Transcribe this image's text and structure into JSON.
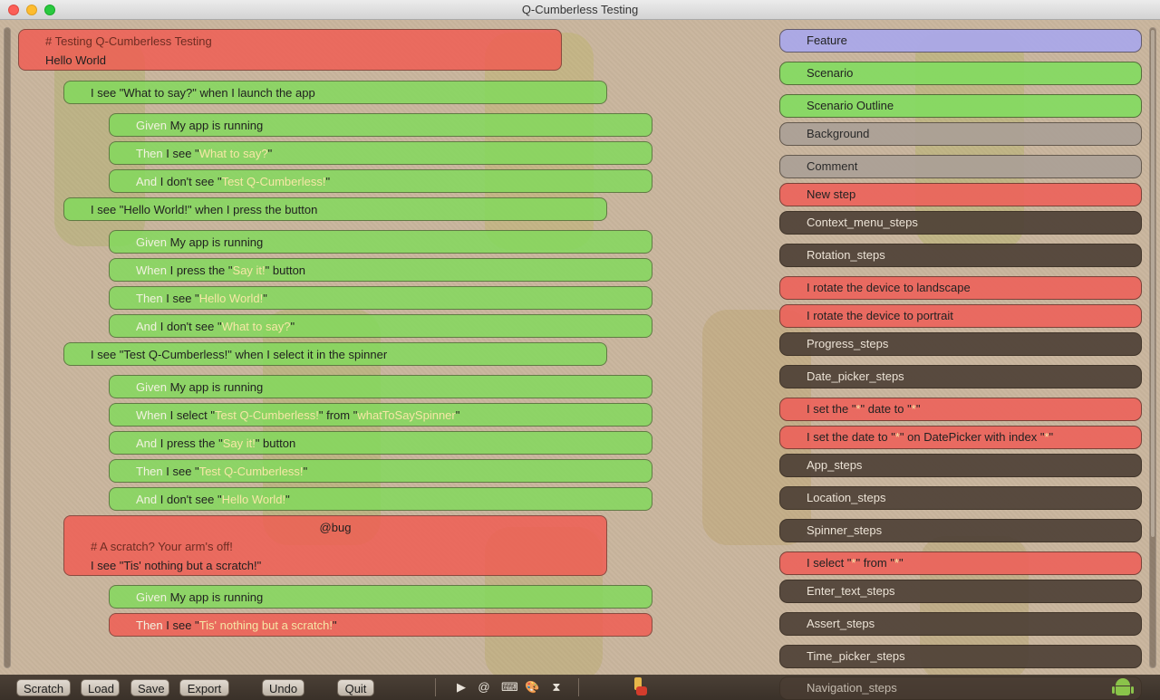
{
  "window": {
    "title": "Q-Cumberless Testing"
  },
  "editor": {
    "feature": {
      "comment": "# Testing Q-Cumberless Testing",
      "name": "Hello World"
    },
    "scenarios": [
      {
        "title": "I see \"What to say?\" when I launch the app",
        "steps": [
          {
            "keyword": "Given",
            "pre": "My app is running",
            "q1": "",
            "mid": "",
            "q2": "",
            "post": "",
            "result": "pass"
          },
          {
            "keyword": "Then",
            "pre": "I see \"",
            "q1": "What to say?",
            "mid": "\"",
            "q2": "",
            "post": "",
            "result": "pass"
          },
          {
            "keyword": "And",
            "pre": "I don't see \"",
            "q1": "Test Q-Cumberless!",
            "mid": "\"",
            "q2": "",
            "post": "",
            "result": "pass"
          }
        ]
      },
      {
        "title": "I see \"Hello World!\" when I press the button",
        "steps": [
          {
            "keyword": "Given",
            "pre": "My app is running",
            "q1": "",
            "mid": "",
            "q2": "",
            "post": "",
            "result": "pass"
          },
          {
            "keyword": "When",
            "pre": "I press the \"",
            "q1": "Say it!",
            "mid": "\" button",
            "q2": "",
            "post": "",
            "result": "pass"
          },
          {
            "keyword": "Then",
            "pre": "I see \"",
            "q1": "Hello World!",
            "mid": "\"",
            "q2": "",
            "post": "",
            "result": "pass"
          },
          {
            "keyword": "And",
            "pre": "I don't see \"",
            "q1": "What to say?",
            "mid": "\"",
            "q2": "",
            "post": "",
            "result": "pass"
          }
        ]
      },
      {
        "title": "I see \"Test Q-Cumberless!\" when I select it in the spinner",
        "steps": [
          {
            "keyword": "Given",
            "pre": "My app is running",
            "q1": "",
            "mid": "",
            "q2": "",
            "post": "",
            "result": "pass"
          },
          {
            "keyword": "When",
            "pre": "I select \"",
            "q1": "Test Q-Cumberless!",
            "mid": "\" from \"",
            "q2": "whatToSaySpinner",
            "post": "\"",
            "result": "pass"
          },
          {
            "keyword": "And",
            "pre": "I press the \"",
            "q1": "Say it!",
            "mid": "\" button",
            "q2": "",
            "post": "",
            "result": "pass"
          },
          {
            "keyword": "Then",
            "pre": "I see \"",
            "q1": "Test Q-Cumberless!",
            "mid": "\"",
            "q2": "",
            "post": "",
            "result": "pass"
          },
          {
            "keyword": "And",
            "pre": "I don't see \"",
            "q1": "Hello World!",
            "mid": "\"",
            "q2": "",
            "post": "",
            "result": "pass"
          }
        ]
      },
      {
        "tag": "@bug",
        "comment": "# A scratch? Your arm's off!",
        "title": "I see \"Tis' nothing but a scratch!\"",
        "steps": [
          {
            "keyword": "Given",
            "pre": "My app is running",
            "q1": "",
            "mid": "",
            "q2": "",
            "post": "",
            "result": "pass"
          },
          {
            "keyword": "Then",
            "pre": "I see \"",
            "q1": "Tis' nothing but a scratch!",
            "mid": "\"",
            "q2": "",
            "post": "",
            "result": "fail"
          }
        ]
      }
    ]
  },
  "palette": {
    "items": [
      {
        "pre": "Feature",
        "q1": "",
        "mid": "",
        "q2": "",
        "post": "",
        "style": "feat"
      },
      {
        "pre": "Scenario",
        "q1": "",
        "mid": "",
        "q2": "",
        "post": "",
        "style": "green"
      },
      {
        "pre": "Scenario Outline",
        "q1": "",
        "mid": "",
        "q2": "",
        "post": "",
        "style": "green"
      },
      {
        "pre": "Background",
        "q1": "",
        "mid": "",
        "q2": "",
        "post": "",
        "style": "grey"
      },
      {
        "pre": "Comment",
        "q1": "",
        "mid": "",
        "q2": "",
        "post": "",
        "style": "grey"
      },
      {
        "pre": "New step",
        "q1": "",
        "mid": "",
        "q2": "",
        "post": "",
        "style": "red"
      },
      {
        "pre": "Context_menu_steps",
        "q1": "",
        "mid": "",
        "q2": "",
        "post": "",
        "style": "dark"
      },
      {
        "pre": "Rotation_steps",
        "q1": "",
        "mid": "",
        "q2": "",
        "post": "",
        "style": "dark"
      },
      {
        "pre": "I rotate the device to landscape",
        "q1": "",
        "mid": "",
        "q2": "",
        "post": "",
        "style": "red"
      },
      {
        "pre": "I rotate the device to portrait",
        "q1": "",
        "mid": "",
        "q2": "",
        "post": "",
        "style": "red"
      },
      {
        "pre": "Progress_steps",
        "q1": "",
        "mid": "",
        "q2": "",
        "post": "",
        "style": "dark"
      },
      {
        "pre": "Date_picker_steps",
        "q1": "",
        "mid": "",
        "q2": "",
        "post": "",
        "style": "dark"
      },
      {
        "pre": "I set the \"",
        "q1": "*",
        "mid": "\" date to \"",
        "q2": "*",
        "post": "\"",
        "style": "red"
      },
      {
        "pre": "I set the date to \"",
        "q1": "*",
        "mid": "\" on DatePicker with index \"",
        "q2": "*",
        "post": "\"",
        "style": "red"
      },
      {
        "pre": "App_steps",
        "q1": "",
        "mid": "",
        "q2": "",
        "post": "",
        "style": "dark"
      },
      {
        "pre": "Location_steps",
        "q1": "",
        "mid": "",
        "q2": "",
        "post": "",
        "style": "dark"
      },
      {
        "pre": "Spinner_steps",
        "q1": "",
        "mid": "",
        "q2": "",
        "post": "",
        "style": "dark"
      },
      {
        "pre": "I select \"",
        "q1": "*",
        "mid": "\" from \"",
        "q2": "*",
        "post": "\"",
        "style": "red"
      },
      {
        "pre": "Enter_text_steps",
        "q1": "",
        "mid": "",
        "q2": "",
        "post": "",
        "style": "dark"
      },
      {
        "pre": "Assert_steps",
        "q1": "",
        "mid": "",
        "q2": "",
        "post": "",
        "style": "dark"
      },
      {
        "pre": "Time_picker_steps",
        "q1": "",
        "mid": "",
        "q2": "",
        "post": "",
        "style": "dark"
      },
      {
        "pre": "Navigation_steps",
        "q1": "",
        "mid": "",
        "q2": "",
        "post": "",
        "style": "dark"
      }
    ]
  },
  "toolbar": {
    "buttons": [
      "Scratch",
      "Load",
      "Save",
      "Export",
      "Undo",
      "Quit"
    ],
    "icons": [
      {
        "name": "play-icon",
        "glyph": "▶"
      },
      {
        "name": "at-icon",
        "glyph": "@"
      },
      {
        "name": "terminal-icon",
        "glyph": "⌨"
      },
      {
        "name": "palette-icon",
        "glyph": "🎨"
      },
      {
        "name": "hourglass-icon",
        "glyph": "⧗"
      }
    ]
  },
  "colors": {
    "pass": "#80da5a",
    "fail": "#f05a50",
    "feature": "#aaa8e8",
    "group": "#4b3e34",
    "keyword": "#f2f2e0",
    "quoted": "#f6e7a6"
  }
}
